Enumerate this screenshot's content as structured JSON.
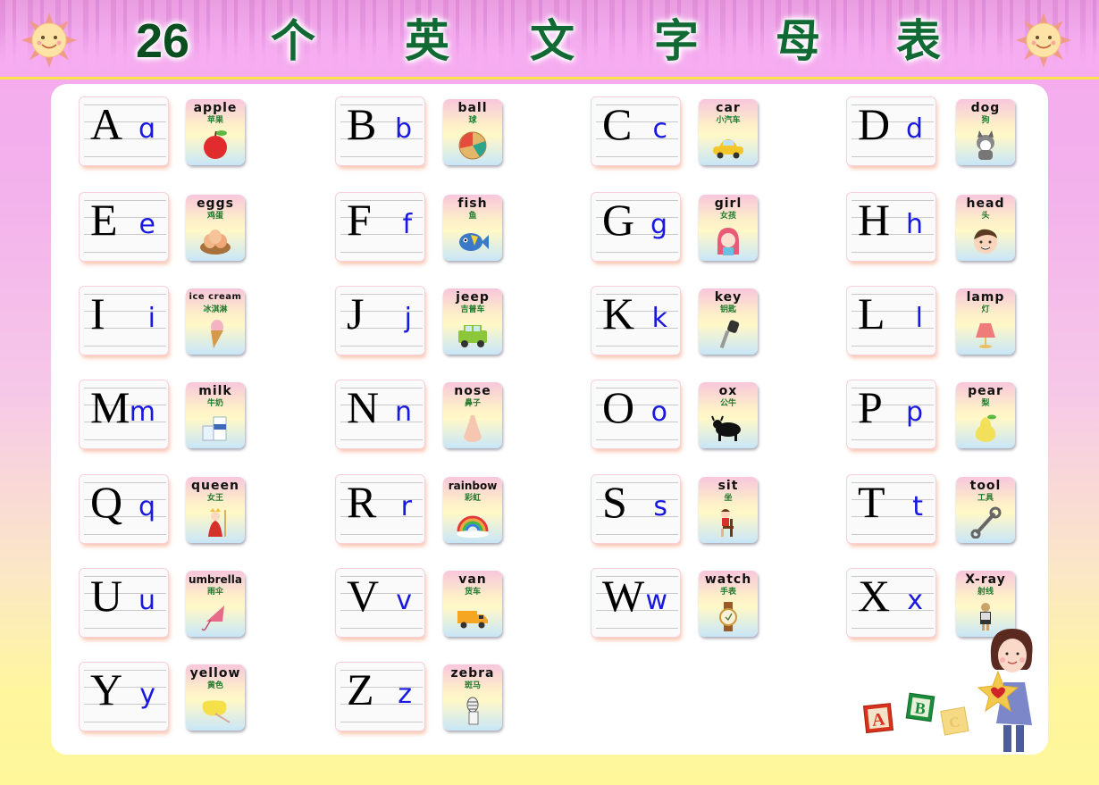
{
  "header": {
    "title_chars": [
      "26",
      "个",
      "英",
      "文",
      "字",
      "母",
      "表"
    ],
    "title_text": "26个英文字母表",
    "left_icon": "smiling-sun-icon",
    "right_icon": "smiling-sun-icon"
  },
  "colors": {
    "title_green": "#116a33",
    "uppercase": "#000000",
    "lowercase": "#1818e0",
    "chinese_label": "#1f7a2c",
    "header_line": "#ffe34a",
    "bg_top": "#f4a8ee",
    "bg_bottom": "#fff79a"
  },
  "letters": [
    {
      "upper": "A",
      "lower": "ɑ",
      "word": "apple",
      "zh": "苹果",
      "icon": "apple-icon"
    },
    {
      "upper": "B",
      "lower": "b",
      "word": "ball",
      "zh": "球",
      "icon": "ball-icon"
    },
    {
      "upper": "C",
      "lower": "c",
      "word": "car",
      "zh": "小汽车",
      "icon": "taxi-car-icon"
    },
    {
      "upper": "D",
      "lower": "d",
      "word": "dog",
      "zh": "狗",
      "icon": "dog-icon"
    },
    {
      "upper": "E",
      "lower": "e",
      "word": "eggs",
      "zh": "鸡蛋",
      "icon": "eggs-nest-icon"
    },
    {
      "upper": "F",
      "lower": "f",
      "word": "fish",
      "zh": "鱼",
      "icon": "fish-icon"
    },
    {
      "upper": "G",
      "lower": "g",
      "word": "girl",
      "zh": "女孩",
      "icon": "girl-icon"
    },
    {
      "upper": "H",
      "lower": "h",
      "word": "head",
      "zh": "头",
      "icon": "head-icon"
    },
    {
      "upper": "I",
      "lower": "i",
      "word": "ice cream",
      "zh": "冰淇淋",
      "icon": "ice-cream-icon"
    },
    {
      "upper": "J",
      "lower": "j",
      "word": "jeep",
      "zh": "吉普车",
      "icon": "jeep-icon"
    },
    {
      "upper": "K",
      "lower": "k",
      "word": "key",
      "zh": "钥匙",
      "icon": "key-icon"
    },
    {
      "upper": "L",
      "lower": "l",
      "word": "lamp",
      "zh": "灯",
      "icon": "lamp-icon"
    },
    {
      "upper": "M",
      "lower": "m",
      "word": "milk",
      "zh": "牛奶",
      "icon": "milk-icon"
    },
    {
      "upper": "N",
      "lower": "n",
      "word": "nose",
      "zh": "鼻子",
      "icon": "nose-icon"
    },
    {
      "upper": "O",
      "lower": "o",
      "word": "ox",
      "zh": "公牛",
      "icon": "ox-icon"
    },
    {
      "upper": "P",
      "lower": "p",
      "word": "pear",
      "zh": "梨",
      "icon": "pear-icon"
    },
    {
      "upper": "Q",
      "lower": "q",
      "word": "queen",
      "zh": "女王",
      "icon": "queen-icon"
    },
    {
      "upper": "R",
      "lower": "r",
      "word": "rainbow",
      "zh": "彩虹",
      "icon": "rainbow-icon"
    },
    {
      "upper": "S",
      "lower": "s",
      "word": "sit",
      "zh": "坐",
      "icon": "sitting-boy-icon"
    },
    {
      "upper": "T",
      "lower": "t",
      "word": "tool",
      "zh": "工具",
      "icon": "wrench-icon"
    },
    {
      "upper": "U",
      "lower": "u",
      "word": "umbrella",
      "zh": "雨伞",
      "icon": "umbrella-icon"
    },
    {
      "upper": "V",
      "lower": "v",
      "word": "van",
      "zh": "货车",
      "icon": "van-truck-icon"
    },
    {
      "upper": "W",
      "lower": "w",
      "word": "watch",
      "zh": "手表",
      "icon": "watch-icon"
    },
    {
      "upper": "X",
      "lower": "x",
      "word": "X-ray",
      "zh": "射线",
      "icon": "x-ray-person-icon"
    },
    {
      "upper": "Y",
      "lower": "y",
      "word": "yellow",
      "zh": "黄色",
      "icon": "yellow-paint-icon"
    },
    {
      "upper": "Z",
      "lower": "z",
      "word": "zebra",
      "zh": "斑马",
      "icon": "zebra-icon"
    }
  ],
  "decoration": {
    "blocks": [
      "A",
      "B",
      "C"
    ],
    "girl_icon": "girl-holding-star-icon"
  }
}
